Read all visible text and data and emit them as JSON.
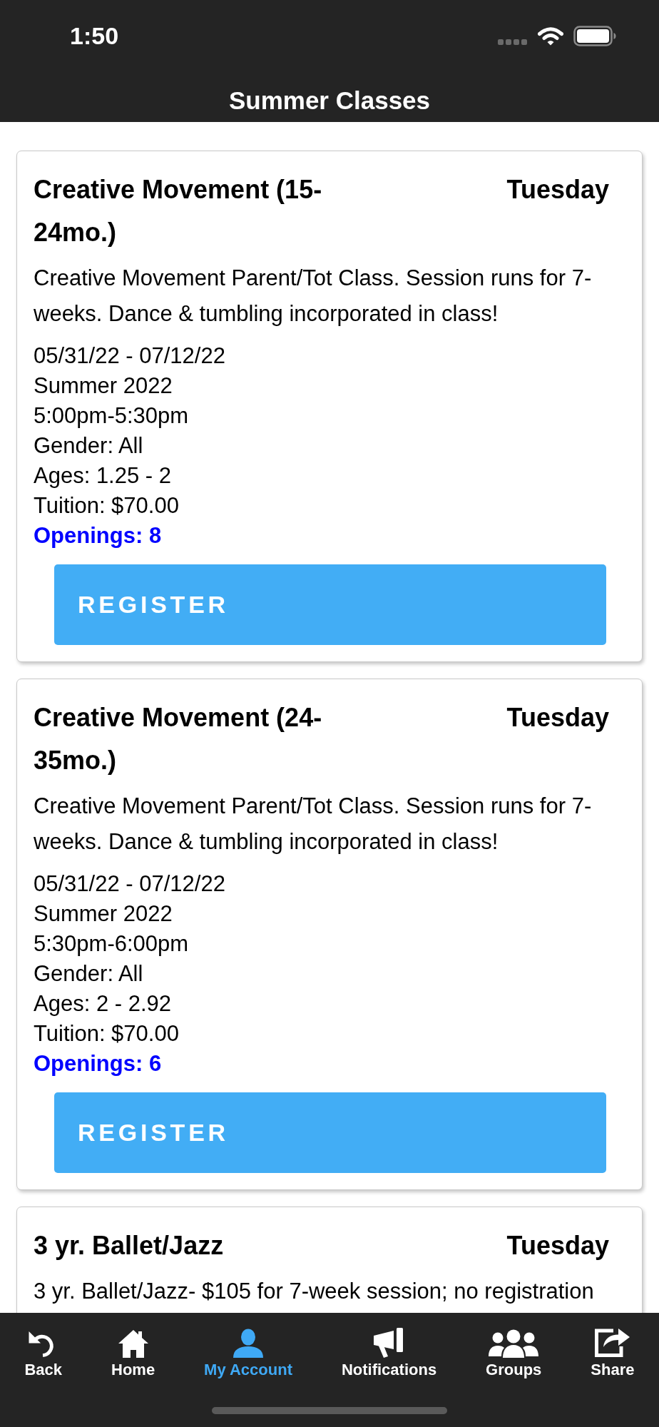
{
  "status_bar": {
    "time": "1:50"
  },
  "header": {
    "title": "Summer Classes"
  },
  "classes": [
    {
      "title": "Creative Movement (15-24mo.)",
      "day": "Tuesday",
      "description": "Creative Movement Parent/Tot Class. Session runs for 7-weeks. Dance & tumbling incorporated in class!",
      "details": [
        "05/31/22 - 07/12/22",
        "Summer 2022",
        "5:00pm-5:30pm",
        "Gender: All",
        "Ages: 1.25 - 2",
        "Tuition: $70.00"
      ],
      "openings": "Openings: 8",
      "button": "REGISTER"
    },
    {
      "title": "Creative Movement (24-35mo.)",
      "day": "Tuesday",
      "description": "Creative Movement Parent/Tot Class. Session runs for 7-weeks. Dance & tumbling incorporated in class!",
      "details": [
        "05/31/22 - 07/12/22",
        "Summer 2022",
        "5:30pm-6:00pm",
        "Gender: All",
        "Ages: 2 - 2.92",
        "Tuition: $70.00"
      ],
      "openings": "Openings: 6",
      "button": "REGISTER"
    },
    {
      "title": "3 yr. Ballet/Jazz",
      "day": "Tuesday",
      "description": "3 yr. Ballet/Jazz- $105 for 7-week session; no registration"
    }
  ],
  "tab_bar": [
    {
      "label": "Back",
      "selected": false
    },
    {
      "label": "Home",
      "selected": false
    },
    {
      "label": "My Account",
      "selected": true
    },
    {
      "label": "Notifications",
      "selected": false
    },
    {
      "label": "Groups",
      "selected": false
    },
    {
      "label": "Share",
      "selected": false
    }
  ]
}
